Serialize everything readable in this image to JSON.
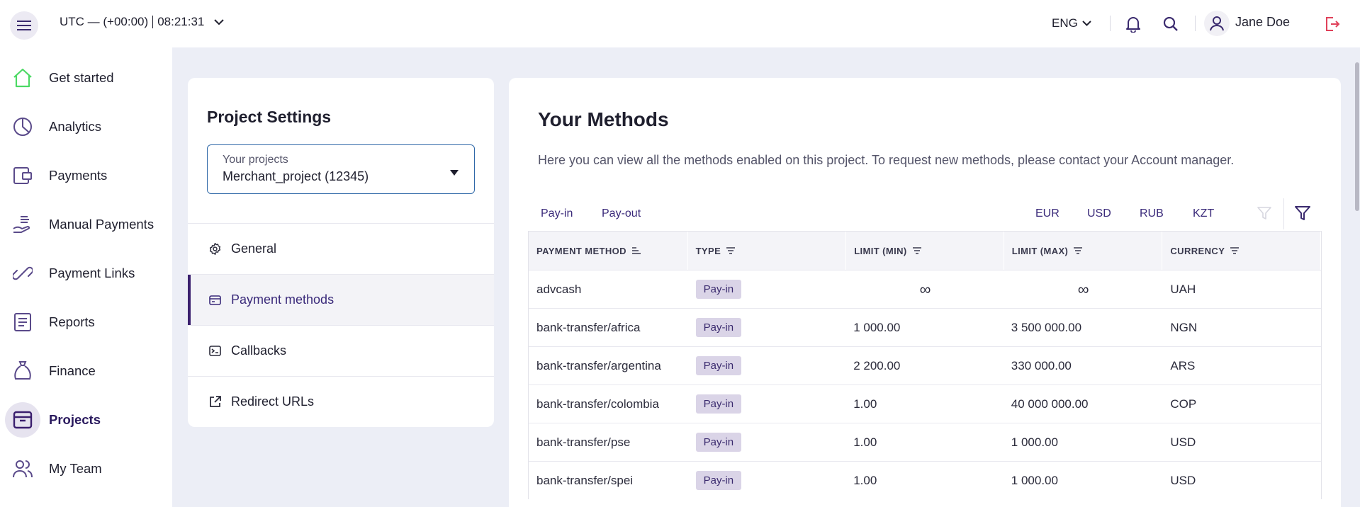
{
  "header": {
    "timezone": "UTC — (+00:00)",
    "time": "08:21:31",
    "language": "ENG",
    "username": "Jane Doe"
  },
  "sidebar": {
    "items": [
      {
        "label": "Get started",
        "icon": "home-icon"
      },
      {
        "label": "Analytics",
        "icon": "pie-chart-icon"
      },
      {
        "label": "Payments",
        "icon": "wallet-icon"
      },
      {
        "label": "Manual Payments",
        "icon": "hand-coins-icon"
      },
      {
        "label": "Payment Links",
        "icon": "link-icon"
      },
      {
        "label": "Reports",
        "icon": "document-icon"
      },
      {
        "label": "Finance",
        "icon": "money-bag-icon"
      },
      {
        "label": "Projects",
        "icon": "archive-icon",
        "active": true
      },
      {
        "label": "My Team",
        "icon": "team-icon"
      }
    ]
  },
  "settings": {
    "title": "Project Settings",
    "project_select": {
      "label": "Your projects",
      "value": "Merchant_project (12345)"
    },
    "items": [
      {
        "label": "General",
        "icon": "gear-icon"
      },
      {
        "label": "Payment methods",
        "icon": "card-icon",
        "active": true
      },
      {
        "label": "Callbacks",
        "icon": "terminal-icon"
      },
      {
        "label": "Redirect URLs",
        "icon": "external-link-icon"
      }
    ]
  },
  "methods": {
    "title": "Your Methods",
    "description": "Here you can view all the methods enabled on this project. To request new methods, please contact your Account manager.",
    "tabs": [
      "Pay-in",
      "Pay-out"
    ],
    "currencies": [
      "EUR",
      "USD",
      "RUB",
      "KZT"
    ],
    "columns": [
      "PAYMENT METHOD",
      "TYPE",
      "LIMIT (MIN)",
      "LIMIT (MAX)",
      "CURRENCY"
    ],
    "rows": [
      {
        "method": "advcash",
        "type": "Pay-in",
        "min": "∞",
        "max": "∞",
        "currency": "UAH"
      },
      {
        "method": "bank-transfer/africa",
        "type": "Pay-in",
        "min": "1 000.00",
        "max": "3 500 000.00",
        "currency": "NGN"
      },
      {
        "method": "bank-transfer/argentina",
        "type": "Pay-in",
        "min": "2 200.00",
        "max": "330 000.00",
        "currency": "ARS"
      },
      {
        "method": "bank-transfer/colombia",
        "type": "Pay-in",
        "min": "1.00",
        "max": "40 000 000.00",
        "currency": "COP"
      },
      {
        "method": "bank-transfer/pse",
        "type": "Pay-in",
        "min": "1.00",
        "max": "1 000.00",
        "currency": "USD"
      },
      {
        "method": "bank-transfer/spei",
        "type": "Pay-in",
        "min": "1.00",
        "max": "1 000.00",
        "currency": "USD"
      }
    ]
  },
  "colors": {
    "accent": "#3a1f6e",
    "badge_bg": "#dad4e7",
    "home_icon": "#4cd964",
    "logout_icon": "#e0415a"
  }
}
